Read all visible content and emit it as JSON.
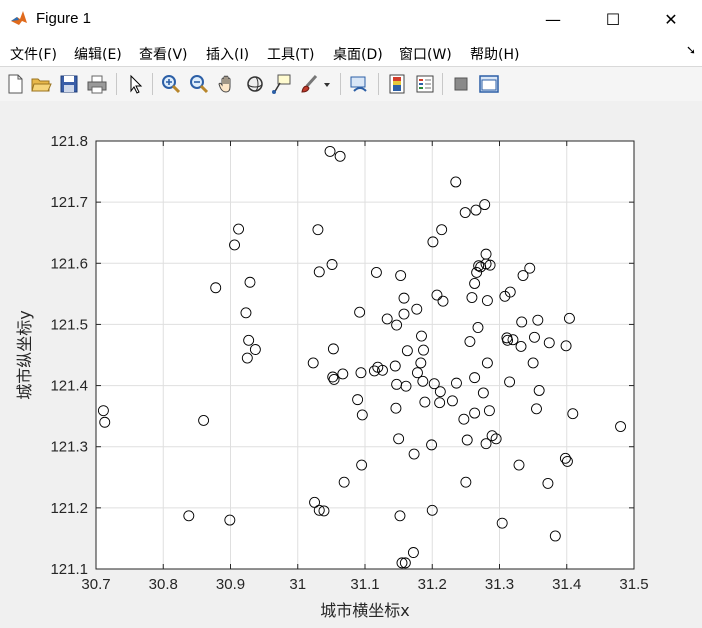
{
  "window": {
    "title": "Figure 1",
    "minimize_glyph": "—",
    "maximize_glyph": "☐",
    "close_glyph": "✕"
  },
  "menu": [
    "文件(F)",
    "编辑(E)",
    "查看(V)",
    "插入(I)",
    "工具(T)",
    "桌面(D)",
    "窗口(W)",
    "帮助(H)"
  ],
  "toolbar_icons": [
    "new-figure-icon",
    "open-file-icon",
    "save-icon",
    "print-icon",
    "select-arrow-icon",
    "zoom-in-icon",
    "zoom-out-icon",
    "pan-hand-icon",
    "rotate-3d-icon",
    "data-cursor-icon",
    "brush-icon",
    "brush-dropdown-icon",
    "link-plot-icon",
    "insert-colorbar-icon",
    "insert-legend-icon",
    "hide-plot-tools-icon",
    "show-plot-tools-icon"
  ],
  "colors": {
    "marker": "#000000",
    "grid": "#dfdfdf",
    "axes_bg": "#ffffff",
    "figure_bg": "#f0f0f0"
  },
  "chart_data": {
    "type": "scatter",
    "xlabel": "城市横坐标x",
    "ylabel": "城市纵坐标y",
    "xlim": [
      30.7,
      31.5
    ],
    "ylim": [
      121.1,
      121.8
    ],
    "xticks": [
      "30.7",
      "30.8",
      "30.9",
      "31",
      "31.1",
      "31.2",
      "31.3",
      "31.4",
      "31.5"
    ],
    "yticks": [
      "121.1",
      "121.2",
      "121.3",
      "121.4",
      "121.5",
      "121.6",
      "121.7",
      "121.8"
    ],
    "grid": true,
    "marker": "open-circle",
    "points": [
      [
        30.711,
        121.359
      ],
      [
        30.713,
        121.34
      ],
      [
        30.838,
        121.187
      ],
      [
        30.86,
        121.343
      ],
      [
        30.878,
        121.56
      ],
      [
        30.899,
        121.18
      ],
      [
        30.906,
        121.63
      ],
      [
        30.912,
        121.656
      ],
      [
        30.923,
        121.519
      ],
      [
        30.925,
        121.445
      ],
      [
        30.927,
        121.474
      ],
      [
        30.929,
        121.569
      ],
      [
        30.937,
        121.459
      ],
      [
        31.023,
        121.437
      ],
      [
        31.025,
        121.209
      ],
      [
        31.03,
        121.655
      ],
      [
        31.032,
        121.196
      ],
      [
        31.032,
        121.586
      ],
      [
        31.039,
        121.195
      ],
      [
        31.048,
        121.783
      ],
      [
        31.051,
        121.598
      ],
      [
        31.052,
        121.414
      ],
      [
        31.053,
        121.46
      ],
      [
        31.054,
        121.41
      ],
      [
        31.063,
        121.775
      ],
      [
        31.067,
        121.419
      ],
      [
        31.069,
        121.242
      ],
      [
        31.089,
        121.377
      ],
      [
        31.092,
        121.52
      ],
      [
        31.094,
        121.421
      ],
      [
        31.095,
        121.27
      ],
      [
        31.096,
        121.352
      ],
      [
        31.114,
        121.424
      ],
      [
        31.117,
        121.585
      ],
      [
        31.119,
        121.43
      ],
      [
        31.126,
        121.425
      ],
      [
        31.133,
        121.509
      ],
      [
        31.145,
        121.432
      ],
      [
        31.146,
        121.363
      ],
      [
        31.147,
        121.499
      ],
      [
        31.147,
        121.402
      ],
      [
        31.15,
        121.313
      ],
      [
        31.152,
        121.187
      ],
      [
        31.153,
        121.58
      ],
      [
        31.155,
        121.11
      ],
      [
        31.158,
        121.543
      ],
      [
        31.158,
        121.517
      ],
      [
        31.16,
        121.11
      ],
      [
        31.161,
        121.399
      ],
      [
        31.163,
        121.457
      ],
      [
        31.172,
        121.127
      ],
      [
        31.173,
        121.288
      ],
      [
        31.177,
        121.525
      ],
      [
        31.178,
        121.421
      ],
      [
        31.183,
        121.437
      ],
      [
        31.184,
        121.481
      ],
      [
        31.186,
        121.407
      ],
      [
        31.187,
        121.458
      ],
      [
        31.189,
        121.373
      ],
      [
        31.199,
        121.303
      ],
      [
        31.2,
        121.196
      ],
      [
        31.201,
        121.635
      ],
      [
        31.203,
        121.403
      ],
      [
        31.207,
        121.548
      ],
      [
        31.211,
        121.372
      ],
      [
        31.212,
        121.39
      ],
      [
        31.214,
        121.655
      ],
      [
        31.216,
        121.538
      ],
      [
        31.23,
        121.375
      ],
      [
        31.235,
        121.733
      ],
      [
        31.236,
        121.404
      ],
      [
        31.247,
        121.345
      ],
      [
        31.249,
        121.683
      ],
      [
        31.25,
        121.242
      ],
      [
        31.252,
        121.311
      ],
      [
        31.256,
        121.472
      ],
      [
        31.259,
        121.544
      ],
      [
        31.263,
        121.355
      ],
      [
        31.263,
        121.567
      ],
      [
        31.263,
        121.413
      ],
      [
        31.265,
        121.687
      ],
      [
        31.266,
        121.585
      ],
      [
        31.268,
        121.495
      ],
      [
        31.269,
        121.596
      ],
      [
        31.272,
        121.594
      ],
      [
        31.276,
        121.388
      ],
      [
        31.278,
        121.696
      ],
      [
        31.28,
        121.615
      ],
      [
        31.28,
        121.599
      ],
      [
        31.28,
        121.305
      ],
      [
        31.282,
        121.539
      ],
      [
        31.282,
        121.437
      ],
      [
        31.285,
        121.359
      ],
      [
        31.286,
        121.597
      ],
      [
        31.289,
        121.318
      ],
      [
        31.295,
        121.313
      ],
      [
        31.304,
        121.175
      ],
      [
        31.308,
        121.546
      ],
      [
        31.311,
        121.478
      ],
      [
        31.312,
        121.474
      ],
      [
        31.315,
        121.406
      ],
      [
        31.316,
        121.553
      ],
      [
        31.32,
        121.475
      ],
      [
        31.329,
        121.27
      ],
      [
        31.332,
        121.464
      ],
      [
        31.333,
        121.504
      ],
      [
        31.335,
        121.58
      ],
      [
        31.345,
        121.592
      ],
      [
        31.35,
        121.437
      ],
      [
        31.352,
        121.479
      ],
      [
        31.355,
        121.362
      ],
      [
        31.357,
        121.507
      ],
      [
        31.359,
        121.392
      ],
      [
        31.372,
        121.24
      ],
      [
        31.374,
        121.47
      ],
      [
        31.383,
        121.154
      ],
      [
        31.398,
        121.281
      ],
      [
        31.399,
        121.465
      ],
      [
        31.401,
        121.276
      ],
      [
        31.404,
        121.51
      ],
      [
        31.409,
        121.354
      ],
      [
        31.48,
        121.333
      ]
    ]
  }
}
